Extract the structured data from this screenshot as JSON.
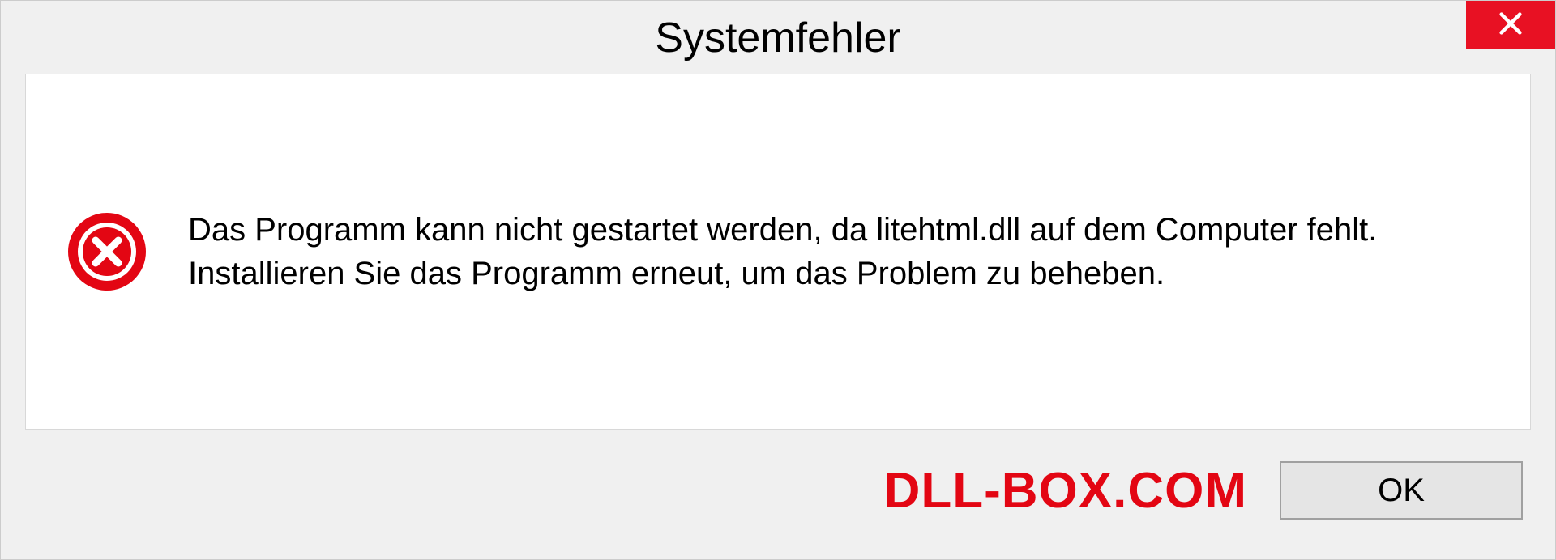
{
  "dialog": {
    "title": "Systemfehler",
    "message": "Das Programm kann nicht gestartet werden, da litehtml.dll auf dem Computer fehlt. Installieren Sie das Programm erneut, um das Problem zu beheben.",
    "ok_label": "OK"
  },
  "watermark": {
    "text": "DLL-BOX.COM"
  },
  "colors": {
    "close_button": "#e81123",
    "error_icon": "#e30613",
    "watermark": "#e30613"
  }
}
